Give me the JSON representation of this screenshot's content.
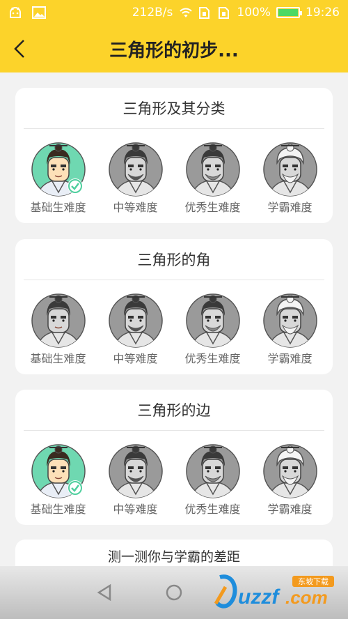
{
  "status_bar": {
    "speed": "212B/s",
    "battery": "100%",
    "time": "19:26",
    "battery_level": 1.0
  },
  "header": {
    "title": "三角形的初步..."
  },
  "cards": [
    {
      "title": "三角形及其分类",
      "levels": [
        {
          "label": "基础生难度",
          "state": "completed"
        },
        {
          "label": "中等难度",
          "state": "locked"
        },
        {
          "label": "优秀生难度",
          "state": "locked"
        },
        {
          "label": "学霸难度",
          "state": "locked"
        }
      ]
    },
    {
      "title": "三角形的角",
      "levels": [
        {
          "label": "基础生难度",
          "state": "locked"
        },
        {
          "label": "中等难度",
          "state": "locked"
        },
        {
          "label": "优秀生难度",
          "state": "locked"
        },
        {
          "label": "学霸难度",
          "state": "locked"
        }
      ]
    },
    {
      "title": "三角形的边",
      "levels": [
        {
          "label": "基础生难度",
          "state": "completed"
        },
        {
          "label": "中等难度",
          "state": "locked"
        },
        {
          "label": "优秀生难度",
          "state": "locked"
        },
        {
          "label": "学霸难度",
          "state": "locked"
        }
      ]
    }
  ],
  "challenge": {
    "title": "测一测你与学霸的差距"
  },
  "watermark": {
    "brand": "uzzf.com",
    "tag": "东坡下载"
  },
  "colors": {
    "accent": "#fcd32a",
    "completed": "#6fd8b1",
    "check": "#4fcf9e"
  }
}
